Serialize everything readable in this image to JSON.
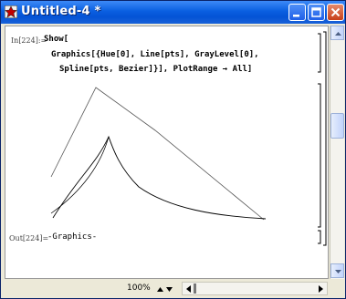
{
  "window": {
    "title": "Untitled-4 *"
  },
  "cells": {
    "input_label": "In[224]:=",
    "input_lines": [
      "Show[",
      "Graphics[{Hue[0], Line[pts], GrayLevel[0],",
      "Spline[pts, Bezier]}], PlotRange → All]"
    ],
    "output_label": "Out[224]=",
    "output_value": "-Graphics-"
  },
  "statusbar": {
    "zoom": "100%"
  },
  "icons": [
    "mathematica-app-icon",
    "minimize-icon",
    "maximize-icon",
    "close-icon",
    "scroll-up-icon",
    "scroll-down-icon",
    "zoom-up-icon",
    "zoom-down-icon",
    "scroll-left-icon",
    "scroll-right-icon"
  ]
}
